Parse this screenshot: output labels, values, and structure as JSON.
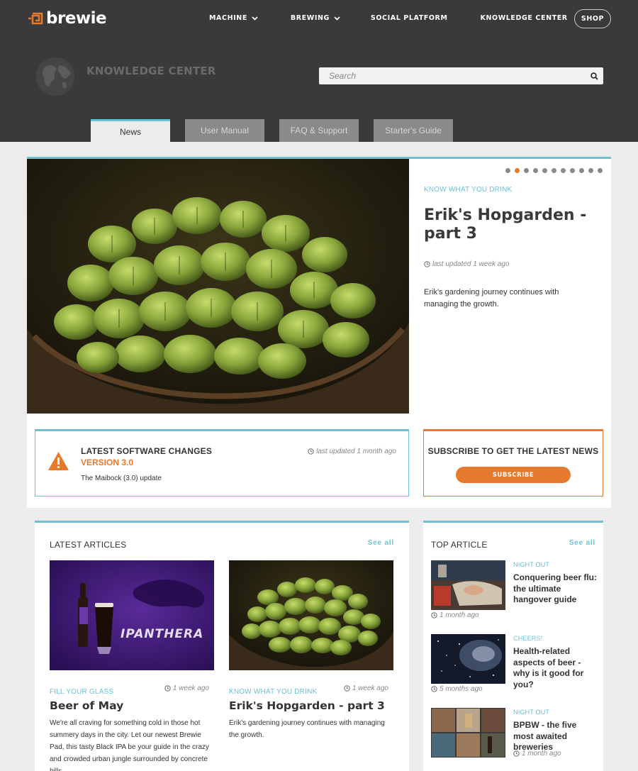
{
  "header": {
    "logo_text": "brewie",
    "nav": [
      {
        "label": "MACHINE",
        "has_dropdown": true
      },
      {
        "label": "BREWING",
        "has_dropdown": true
      },
      {
        "label": "SOCIAL PLATFORM",
        "has_dropdown": false
      },
      {
        "label": "KNOWLEDGE CENTER",
        "has_dropdown": false
      }
    ],
    "shop_label": "SHOP"
  },
  "knowledge_center": {
    "title": "KNOWLEDGE CENTER",
    "search_placeholder": "Search"
  },
  "tabs": [
    {
      "label": "News",
      "active": true
    },
    {
      "label": "User Manual",
      "active": false
    },
    {
      "label": "FAQ & Support",
      "active": false
    },
    {
      "label": "Starter's Guide",
      "active": false
    }
  ],
  "hero": {
    "category": "KNOW WHAT YOU DRINK",
    "title": "Erik's Hopgarden - part 3",
    "updated": "last updated 1 week ago",
    "description": "Erik's gardening journey continues with managing the growth.",
    "slide_count": 11,
    "active_slide": 2
  },
  "software": {
    "title": "LATEST SOFTWARE CHANGES",
    "version": "VERSION 3.0",
    "updated": "last updated 1 month ago",
    "description": "The Maibock (3.0) update"
  },
  "subscribe": {
    "title": "SUBSCRIBE TO GET THE LATEST NEWS",
    "button": "SUBSCRIBE"
  },
  "latest_articles": {
    "title": "LATEST ARTICLES",
    "see_all": "See all",
    "items": [
      {
        "category": "FILL YOUR GLASS",
        "time": "1 week ago",
        "title": "Beer of May",
        "description": "We're all craving for something cold in those hot summery days in the city. Let our newest Brewie Pad, this tasty Black IPA be your guide in the crazy and crowded urban jungle surrounded by concrete hills.",
        "image_text": "IPANTHERA"
      },
      {
        "category": "KNOW WHAT YOU DRINK",
        "time": "1 week ago",
        "title": "Erik's Hopgarden - part 3",
        "description": "Erik's gardening journey continues with managing the growth."
      }
    ]
  },
  "top_article": {
    "title": "TOP ARTICLE",
    "see_all": "See all",
    "items": [
      {
        "category": "NIGHT OUT",
        "title": "Conquering beer flu: the ultimate hangover guide",
        "time": "1 month ago"
      },
      {
        "category": "CHEERS!",
        "title": "Health-related aspects of beer - why is it good for you?",
        "time": "5 months ago"
      },
      {
        "category": "NIGHT OUT",
        "title": "BPBW - the five most awaited breweries",
        "time": "1 month ago"
      }
    ]
  },
  "colors": {
    "accent_blue": "#6cc2d4",
    "accent_orange": "#e5792e",
    "header_bg": "#3a3a3a"
  }
}
